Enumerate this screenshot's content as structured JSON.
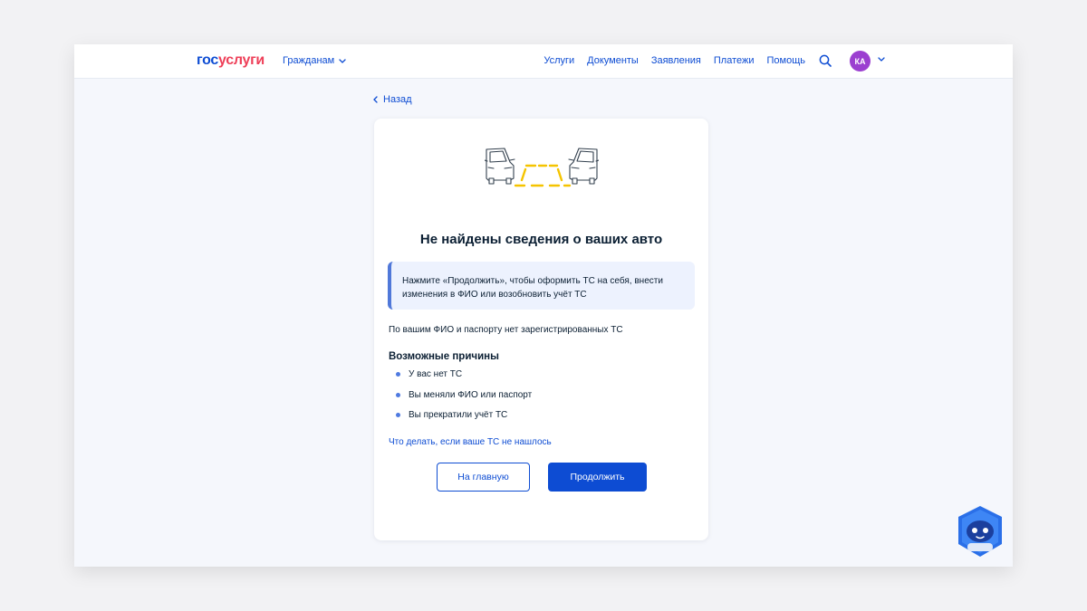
{
  "header": {
    "logo_part1": "гос",
    "logo_part2": "услуги",
    "audience": "Гражданам",
    "nav": [
      "Услуги",
      "Документы",
      "Заявления",
      "Платежи",
      "Помощь"
    ],
    "avatar_initials": "КА",
    "icons": [
      "search-icon",
      "chevron-down-icon"
    ]
  },
  "back_label": "Назад",
  "card": {
    "title": "Не найдены сведения о ваших авто",
    "notice_line1": "Нажмите «Продолжить», чтобы оформить ТС на себя, внести",
    "notice_line2": "изменения в ФИО или возобновить учёт ТС",
    "plain_text": "По вашим ФИО и паспорту нет зарегистрированных ТС",
    "reasons_title": "Возможные причины",
    "reasons": [
      "У вас нет ТС",
      "Вы меняли ФИО или паспорт",
      "Вы прекратили учёт ТС"
    ],
    "help_link": "Что делать, если ваше ТС не нашлось",
    "btn_main": "На главную",
    "btn_continue": "Продолжить"
  },
  "colors": {
    "accent": "#0d4cd3",
    "logo_red": "#ee3f58",
    "avatar_bg": "#9b3fd0",
    "notice_bg": "#edf2fe",
    "notice_border": "#5078d9",
    "illustration_yellow": "#f5c400"
  }
}
